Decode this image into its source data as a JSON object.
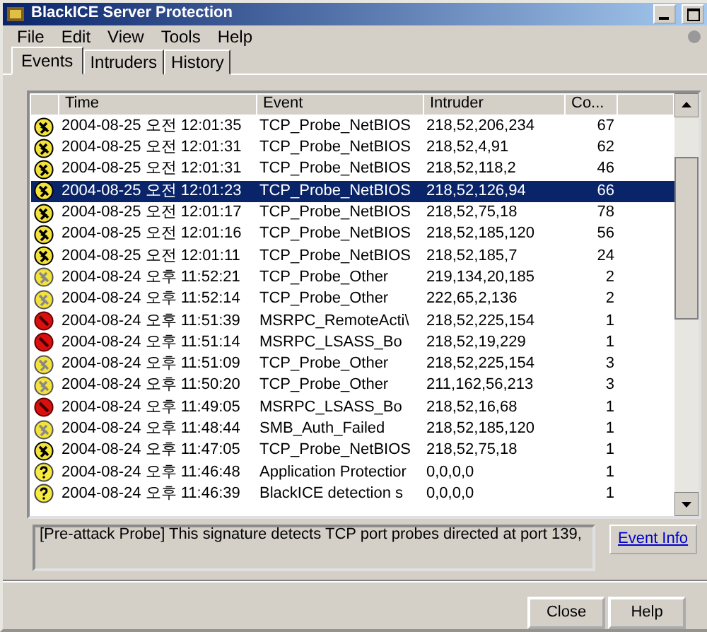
{
  "window": {
    "title": "BlackICE Server Protection"
  },
  "menu": [
    "File",
    "Edit",
    "View",
    "Tools",
    "Help"
  ],
  "tabs": [
    {
      "label": "Events",
      "selected": true
    },
    {
      "label": "Intruders",
      "selected": false
    },
    {
      "label": "History",
      "selected": false
    }
  ],
  "table": {
    "columns": [
      "Time",
      "Event",
      "Intruder",
      "Co..."
    ],
    "rows": [
      {
        "kind": "suspicious",
        "time": "2004-08-25 오전 12:01:35",
        "event": "TCP_Probe_NetBIOS",
        "intruder": "218,52,206,234",
        "count": "67",
        "selected": false
      },
      {
        "kind": "suspicious",
        "time": "2004-08-25 오전 12:01:31",
        "event": "TCP_Probe_NetBIOS",
        "intruder": "218,52,4,91",
        "count": "62",
        "selected": false
      },
      {
        "kind": "suspicious",
        "time": "2004-08-25 오전 12:01:31",
        "event": "TCP_Probe_NetBIOS",
        "intruder": "218,52,118,2",
        "count": "46",
        "selected": false
      },
      {
        "kind": "suspicious",
        "time": "2004-08-25 오전 12:01:23",
        "event": "TCP_Probe_NetBIOS",
        "intruder": "218,52,126,94",
        "count": "66",
        "selected": true
      },
      {
        "kind": "suspicious",
        "time": "2004-08-25 오전 12:01:17",
        "event": "TCP_Probe_NetBIOS",
        "intruder": "218,52,75,18",
        "count": "78",
        "selected": false
      },
      {
        "kind": "suspicious",
        "time": "2004-08-25 오전 12:01:16",
        "event": "TCP_Probe_NetBIOS",
        "intruder": "218,52,185,120",
        "count": "56",
        "selected": false
      },
      {
        "kind": "suspicious",
        "time": "2004-08-25 오전 12:01:11",
        "event": "TCP_Probe_NetBIOS",
        "intruder": "218,52,185,7",
        "count": "24",
        "selected": false
      },
      {
        "kind": "faded",
        "time": "2004-08-24 오후 11:52:21",
        "event": "TCP_Probe_Other",
        "intruder": "219,134,20,185",
        "count": "2",
        "selected": false
      },
      {
        "kind": "faded",
        "time": "2004-08-24 오후 11:52:14",
        "event": "TCP_Probe_Other",
        "intruder": "222,65,2,136",
        "count": "2",
        "selected": false
      },
      {
        "kind": "critical",
        "time": "2004-08-24 오후 11:51:39",
        "event": "MSRPC_RemoteActi\\",
        "intruder": "218,52,225,154",
        "count": "1",
        "selected": false
      },
      {
        "kind": "critical",
        "time": "2004-08-24 오후 11:51:14",
        "event": "MSRPC_LSASS_Bo",
        "intruder": "218,52,19,229",
        "count": "1",
        "selected": false
      },
      {
        "kind": "faded",
        "time": "2004-08-24 오후 11:51:09",
        "event": "TCP_Probe_Other",
        "intruder": "218,52,225,154",
        "count": "3",
        "selected": false
      },
      {
        "kind": "faded",
        "time": "2004-08-24 오후 11:50:20",
        "event": "TCP_Probe_Other",
        "intruder": "211,162,56,213",
        "count": "3",
        "selected": false
      },
      {
        "kind": "critical",
        "time": "2004-08-24 오후 11:49:05",
        "event": "MSRPC_LSASS_Bo",
        "intruder": "218,52,16,68",
        "count": "1",
        "selected": false
      },
      {
        "kind": "faded",
        "time": "2004-08-24 오후 11:48:44",
        "event": "SMB_Auth_Failed",
        "intruder": "218,52,185,120",
        "count": "1",
        "selected": false
      },
      {
        "kind": "suspicious",
        "time": "2004-08-24 오후 11:47:05",
        "event": "TCP_Probe_NetBIOS",
        "intruder": "218,52,75,18",
        "count": "1",
        "selected": false
      },
      {
        "kind": "info",
        "time": "2004-08-24 오후 11:46:48",
        "event": "Application Protectior",
        "intruder": "0,0,0,0",
        "count": "1",
        "selected": false
      },
      {
        "kind": "info",
        "time": "2004-08-24 오후 11:46:39",
        "event": "BlackICE detection s",
        "intruder": "0,0,0,0",
        "count": "1",
        "selected": false
      }
    ]
  },
  "description": "[Pre-attack Probe] This signature detects TCP port probes directed at port 139,",
  "event_info_link": "Event Info",
  "buttons": [
    "Close",
    "Help"
  ]
}
